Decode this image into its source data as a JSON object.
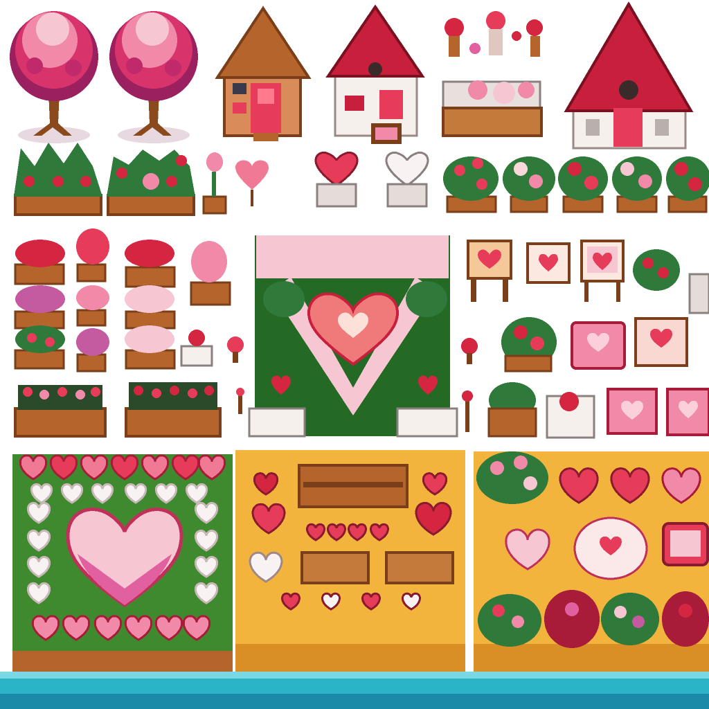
{
  "sheet": {
    "style": "pixel-art sprite sheet",
    "theme": "valentine garden",
    "background": "#ffffff"
  },
  "palette": {
    "pink": "#f08aa8",
    "light_pink": "#f7c6d3",
    "deep_pink": "#d8336a",
    "red": "#d42640",
    "crimson": "#a81c3a",
    "white": "#f8f2f2",
    "wood": "#b5642c",
    "dark_wood": "#7a3e18",
    "roof_red": "#c8203c",
    "roof_brown": "#b5642c",
    "grass": "#3f8a2e",
    "dark_grass": "#256a24",
    "leaf": "#2f7a3a",
    "sand": "#f2b43c",
    "dark_sand": "#d98f26",
    "water": "#2bb4c8",
    "foliage_pink": "#e0508a",
    "foliage_magenta": "#9a2060",
    "trunk": "#8a4a1e"
  },
  "assets": {
    "trees": [
      "cherry-blossom-tree",
      "cherry-blossom-tree"
    ],
    "houses": [
      "wooden-cottage",
      "white-cottage-red-roof",
      "white-house-large"
    ],
    "planters": [
      "red-flower-planter",
      "mixed-flower-planter",
      "pink-rose-box",
      "white-rose-box",
      "red-rose-box"
    ],
    "furniture": [
      "heart-sign-table",
      "heart-picture-stand",
      "heart-frame-stand",
      "pink-heart-tile",
      "garden-bench"
    ],
    "decorations": [
      "heart-balloon",
      "heart-pedestal-red",
      "heart-pedestal-white",
      "heart-fence"
    ],
    "terrain": [
      "grass-heart-plaza",
      "sand-heart-plaza",
      "sand-flowerbed-plaza",
      "water-edge"
    ]
  }
}
